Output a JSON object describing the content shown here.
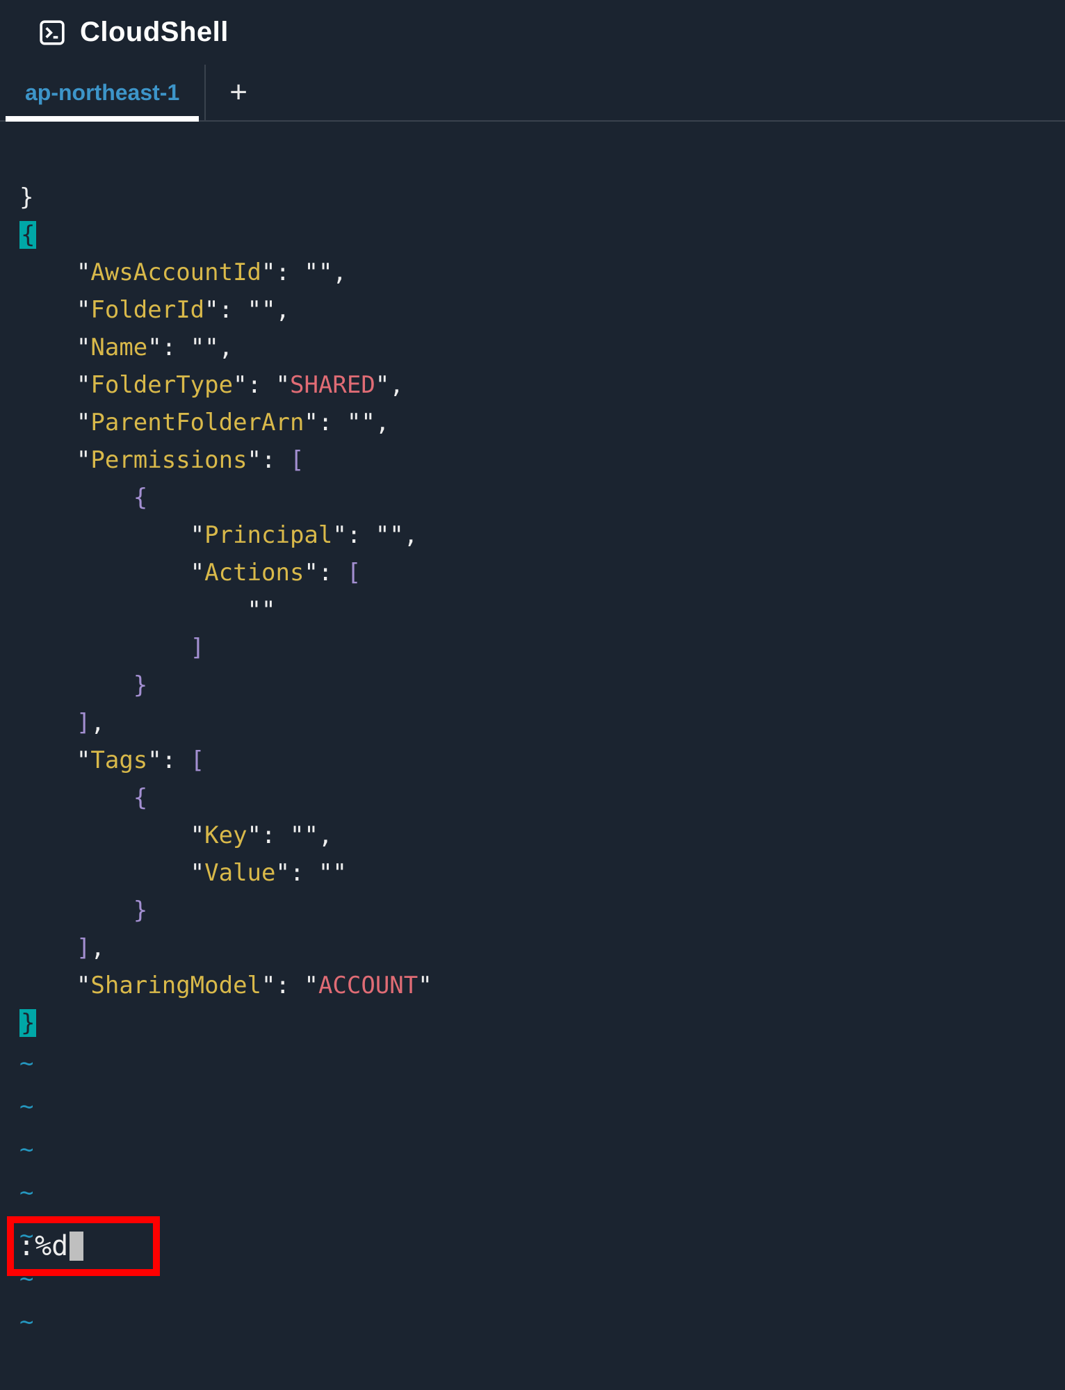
{
  "header": {
    "title": "CloudShell"
  },
  "tabs": {
    "active": "ap-northeast-1"
  },
  "command": ":%d",
  "json_display": {
    "keys": {
      "AwsAccountId": "AwsAccountId",
      "FolderId": "FolderId",
      "Name": "Name",
      "FolderType": "FolderType",
      "ParentFolderArn": "ParentFolderArn",
      "Permissions": "Permissions",
      "Principal": "Principal",
      "Actions": "Actions",
      "Tags": "Tags",
      "Key": "Key",
      "Value": "Value",
      "SharingModel": "SharingModel"
    },
    "values": {
      "AwsAccountId": "",
      "FolderId": "",
      "Name": "",
      "FolderType": "SHARED",
      "ParentFolderArn": "",
      "Principal": "",
      "Actions_item": "",
      "Tags_Key": "",
      "Tags_Value": "",
      "SharingModel": "ACCOUNT"
    }
  }
}
